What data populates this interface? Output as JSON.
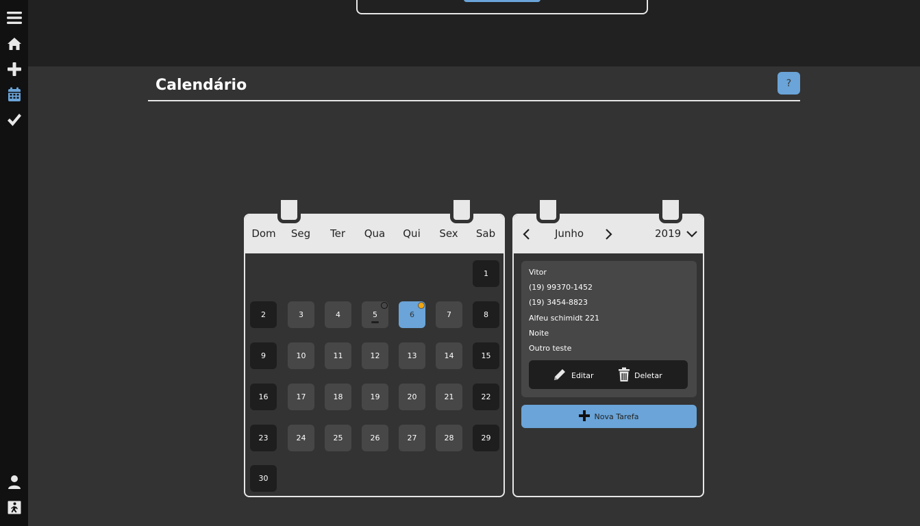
{
  "sidebar": {
    "items": [
      {
        "icon": "menu-icon"
      },
      {
        "icon": "home-icon"
      },
      {
        "icon": "plus-icon"
      },
      {
        "icon": "calendar-icon",
        "active": true
      },
      {
        "icon": "check-icon"
      },
      {
        "icon": "user-icon"
      },
      {
        "icon": "exit-icon"
      }
    ]
  },
  "header": {
    "title": "Calendário",
    "help_label": "?"
  },
  "calendar": {
    "weekdays": [
      "Dom",
      "Seg",
      "Ter",
      "Qua",
      "Qui",
      "Sex",
      "Sab"
    ],
    "days": [
      "1",
      "2",
      "3",
      "4",
      "5",
      "6",
      "7",
      "8",
      "9",
      "10",
      "11",
      "12",
      "13",
      "14",
      "15",
      "16",
      "17",
      "18",
      "19",
      "20",
      "21",
      "22",
      "23",
      "24",
      "25",
      "26",
      "27",
      "28",
      "29",
      "30"
    ],
    "selected_day": "6",
    "first_weekday_index": 6
  },
  "task_panel": {
    "month": "Junho",
    "year": "2019",
    "task": {
      "name": "Vitor",
      "phone1": "(19) 99370-1452",
      "phone2": "(19) 3454-8823",
      "address": "Alfeu schimidt 221",
      "period": "Noite",
      "note": "Outro teste"
    },
    "edit_label": "Editar",
    "delete_label": "Deletar",
    "new_task_label": "Nova Tarefa"
  },
  "colors": {
    "accent": "#6aa4d8",
    "background": "#333333",
    "sidebar": "#111111",
    "marker": "#f4a60d"
  }
}
